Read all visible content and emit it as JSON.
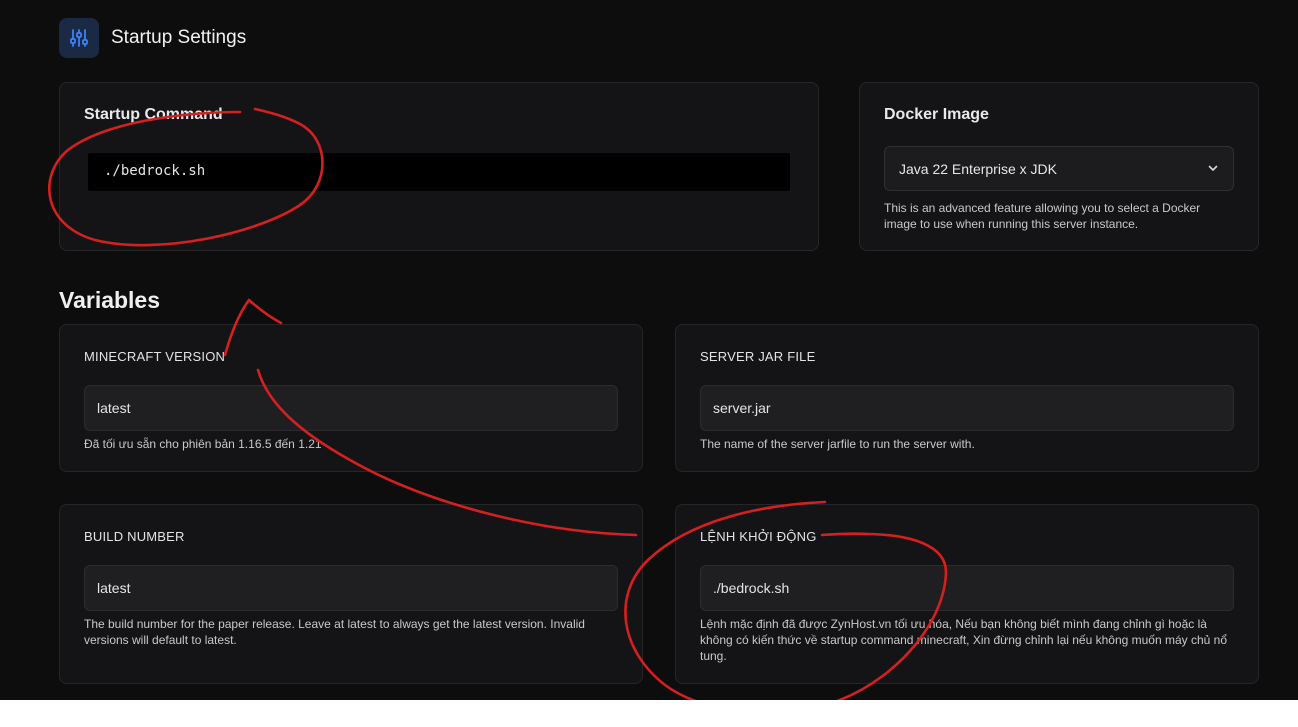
{
  "header": {
    "title": "Startup Settings",
    "icon": "sliders-icon"
  },
  "startup_command": {
    "title": "Startup Command",
    "value": "./bedrock.sh"
  },
  "docker_image": {
    "title": "Docker Image",
    "selected": "Java 22 Enterprise x JDK",
    "help": "This is an advanced feature allowing you to select a Docker image to use when running this server instance."
  },
  "variables": {
    "title": "Variables",
    "minecraft_version": {
      "label": "MINECRAFT VERSION",
      "value": "latest",
      "help": "Đã tối ưu sẵn cho phiên bản 1.16.5 đến 1.21"
    },
    "server_jar_file": {
      "label": "SERVER JAR FILE",
      "value": "server.jar",
      "help": "The name of the server jarfile to run the server with."
    },
    "build_number": {
      "label": "BUILD NUMBER",
      "value": "latest",
      "help": "The build number for the paper release. Leave at latest to always get the latest version. Invalid versions will default to latest."
    },
    "lenh_khoi_dong": {
      "label": "LỆNH KHỞI ĐỘNG",
      "value": "./bedrock.sh",
      "help": "Lệnh mặc định đã được ZynHost.vn tối ưu hóa, Nếu bạn không biết mình đang chỉnh gì hoặc là không có kiến thức về startup command minecraft, Xin đừng chỉnh lại nếu không muốn máy chủ nổ tung."
    }
  },
  "colors": {
    "background": "#0d0d0e",
    "card": "#141416",
    "accent": "#3b82f6",
    "annotation": "#d42020"
  }
}
